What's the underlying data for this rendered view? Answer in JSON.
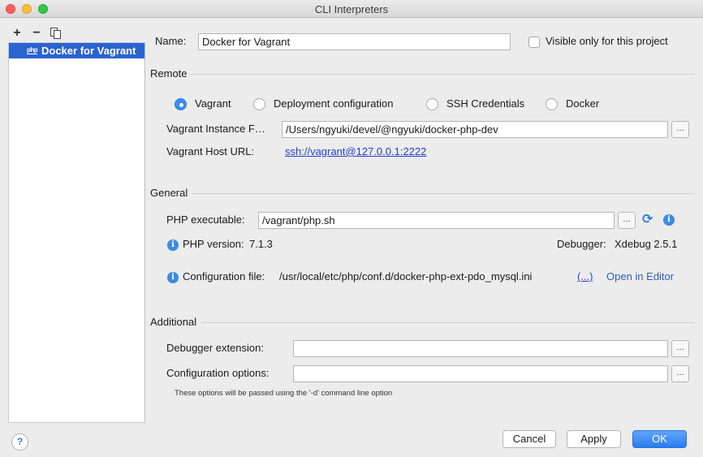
{
  "window": {
    "title": "CLI Interpreters"
  },
  "sidebar": {
    "add_label": "+",
    "remove_label": "−",
    "items": [
      {
        "label": "Docker for Vagrant",
        "icon": "php-icon",
        "icon_text": "php",
        "selected": true
      }
    ]
  },
  "name": {
    "label": "Name:",
    "value": "Docker for Vagrant"
  },
  "visible_only": {
    "label": "Visible only for this project",
    "checked": false
  },
  "remote": {
    "section_label": "Remote",
    "options": [
      {
        "label": "Vagrant",
        "selected": true
      },
      {
        "label": "Deployment configuration",
        "selected": false
      },
      {
        "label": "SSH Credentials",
        "selected": false
      },
      {
        "label": "Docker",
        "selected": false
      }
    ],
    "instance_folder": {
      "label": "Vagrant Instance F…",
      "value": "/Users/ngyuki/devel/@ngyuki/docker-php-dev"
    },
    "host_url": {
      "label": "Vagrant Host URL:",
      "value": "ssh://vagrant@127.0.0.1:2222"
    }
  },
  "general": {
    "section_label": "General",
    "php_executable": {
      "label": "PHP executable:",
      "value": "/vagrant/php.sh"
    },
    "php_version": {
      "label": "PHP version:",
      "value": "7.1.3"
    },
    "debugger": {
      "label": "Debugger:",
      "value": "Xdebug 2.5.1"
    },
    "config_file": {
      "label": "Configuration file:",
      "value": "/usr/local/etc/php/conf.d/docker-php-ext-pdo_mysql.ini",
      "more": "(...)",
      "open_label": "Open in Editor"
    }
  },
  "additional": {
    "section_label": "Additional",
    "debugger_extension": {
      "label": "Debugger extension:",
      "value": ""
    },
    "config_options": {
      "label": "Configuration options:",
      "value": ""
    },
    "hint": "These options will be passed using the '-d' command line option"
  },
  "browse_label": "...",
  "footer": {
    "help_label": "?",
    "cancel": "Cancel",
    "apply": "Apply",
    "ok": "OK"
  },
  "colors": {
    "accent": "#2b63d1",
    "primary_button": "#2c7cf0",
    "link": "#2540c9"
  }
}
